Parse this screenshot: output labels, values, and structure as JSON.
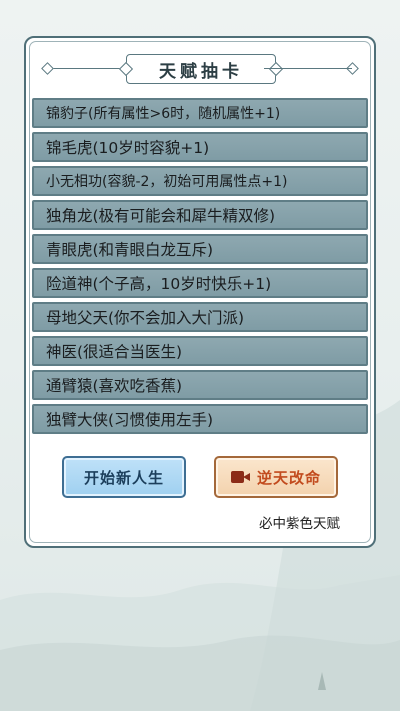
{
  "panel": {
    "title": "天赋抽卡"
  },
  "talents": [
    {
      "label": "锦豹子(所有属性>6时，随机属性+1)",
      "small": true
    },
    {
      "label": "锦毛虎(10岁时容貌+1)",
      "small": false
    },
    {
      "label": "小无相功(容貌-2，初始可用属性点+1)",
      "small": true
    },
    {
      "label": "独角龙(极有可能会和犀牛精双修)",
      "small": false
    },
    {
      "label": "青眼虎(和青眼白龙互斥)",
      "small": false
    },
    {
      "label": "险道神(个子高，10岁时快乐+1)",
      "small": false
    },
    {
      "label": "母地父天(你不会加入大门派)",
      "small": false
    },
    {
      "label": "神医(很适合当医生)",
      "small": false
    },
    {
      "label": "通臂猿(喜欢吃香蕉)",
      "small": false
    },
    {
      "label": "独臂大侠(习惯使用左手)",
      "small": false
    }
  ],
  "buttons": {
    "start_label": "开始新人生",
    "reverse_label": "逆天改命"
  },
  "note": "必中紫色天赋",
  "icons": {
    "reverse_button_icon": "video-camera-icon"
  },
  "colors": {
    "item_bg": "#8ea8b0",
    "start_btn_bg": "#bfe1f8",
    "reverse_btn_bg": "#fbe6cd",
    "reverse_btn_text": "#c24b1e"
  }
}
